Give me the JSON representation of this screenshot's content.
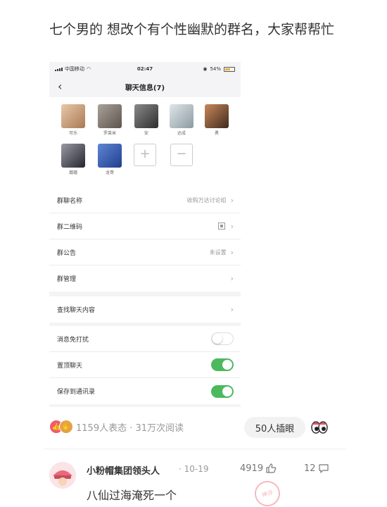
{
  "post": {
    "title": "七个男的 想改个有个性幽默的群名，大家帮帮忙"
  },
  "phone": {
    "status": {
      "carrier": "中国移动",
      "time": "02:47",
      "battery": "54%"
    },
    "nav": {
      "back_icon": "chevron-left-icon",
      "title": "聊天信息(7)"
    },
    "members": [
      {
        "name": "可乐",
        "color": "#c89b7b"
      },
      {
        "name": "罗莱米",
        "color": "#8a7f76"
      },
      {
        "name": "安",
        "color": "#5b5b5b"
      },
      {
        "name": "达成",
        "color": "#b9c4c8"
      },
      {
        "name": "勇",
        "color": "#6e4a36"
      },
      {
        "name": "璐璐",
        "color": "#4a4a55"
      },
      {
        "name": "龙哥",
        "color": "#3d63b8"
      }
    ],
    "add_icon": "plus-icon",
    "remove_icon": "minus-icon",
    "settings": {
      "group_name": {
        "label": "群聊名称",
        "value": "收购万达讨论组"
      },
      "qr_code": {
        "label": "群二维码",
        "icon": "qr-code-icon"
      },
      "notice": {
        "label": "群公告",
        "value": "未设置"
      },
      "manage": {
        "label": "群管理"
      },
      "search_history": {
        "label": "查找聊天内容"
      },
      "mute": {
        "label": "消息免打扰",
        "on": false
      },
      "sticky": {
        "label": "置顶聊天",
        "on": true
      },
      "save_contacts": {
        "label": "保存到通讯录",
        "on": true
      }
    },
    "toggle_on_color": "#4cb95d"
  },
  "stats": {
    "text": "1159人表态 · 31万次阅读",
    "want_button": "50人插眼"
  },
  "comment": {
    "user": "小粉帽集团领头人",
    "time": "· 10-19",
    "likes": "4919",
    "replies": "12",
    "text": "八仙过海淹死一个",
    "stamp": "神评"
  }
}
